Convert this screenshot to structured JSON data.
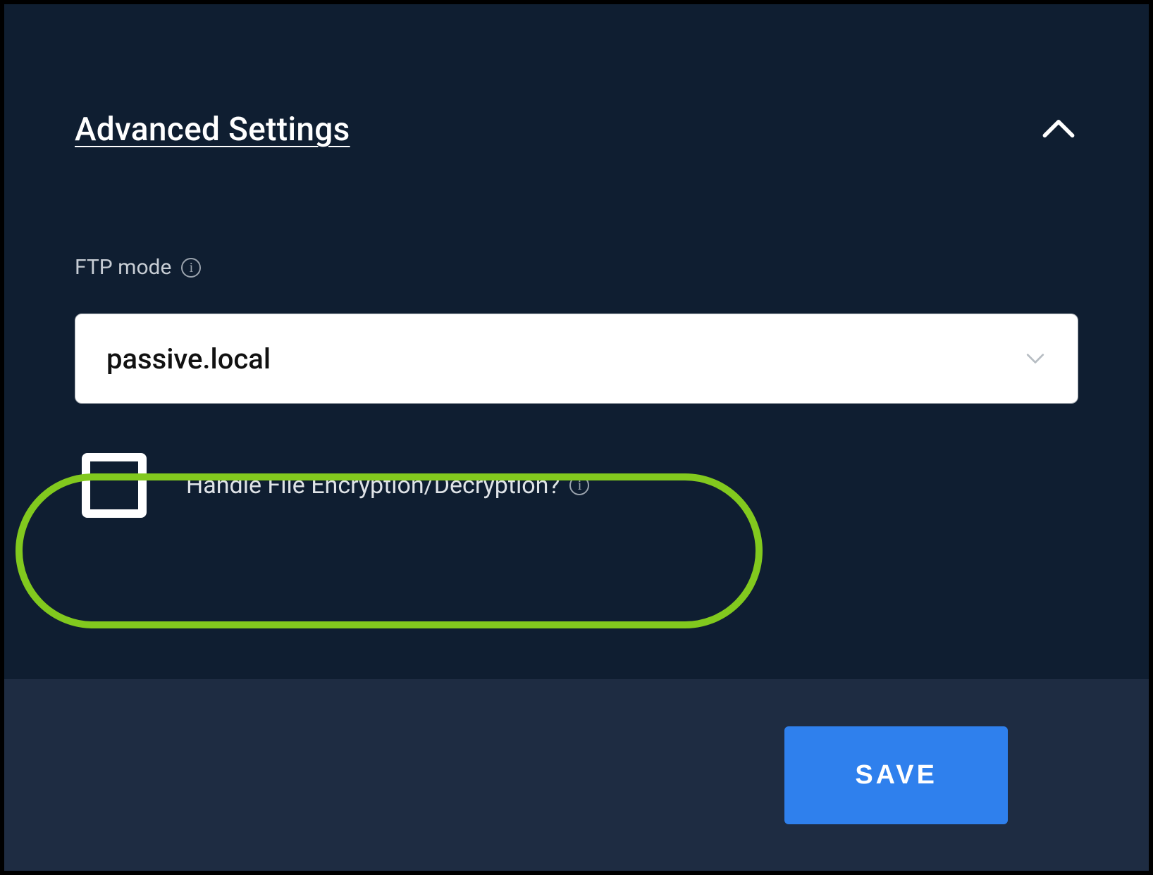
{
  "section": {
    "title": "Advanced Settings"
  },
  "ftp_mode": {
    "label": "FTP mode",
    "value": "passive.local"
  },
  "encryption": {
    "label": "Handle File Encryption/Decryption?",
    "checked": false
  },
  "footer": {
    "save_label": "SAVE"
  }
}
